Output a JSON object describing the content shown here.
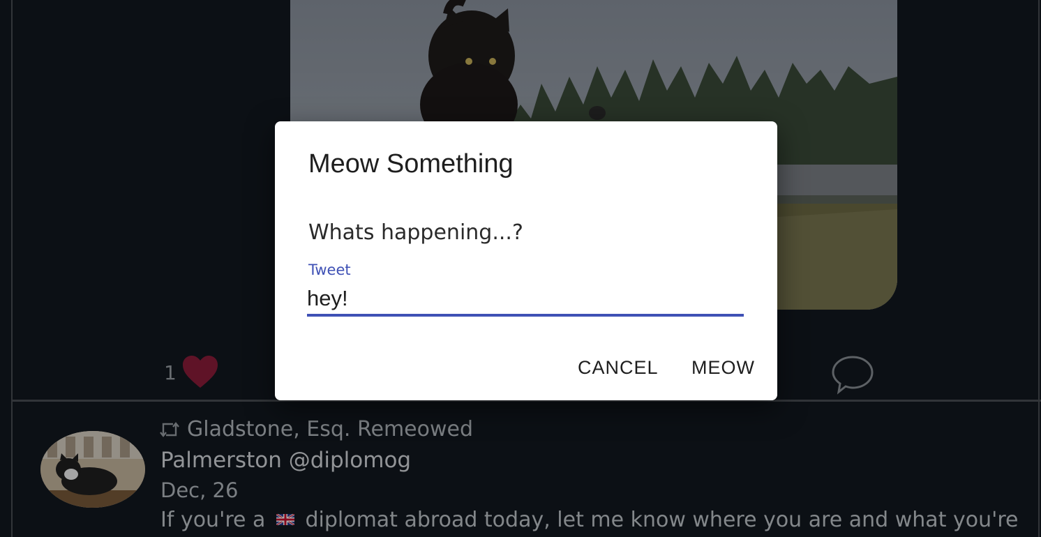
{
  "tweet": {
    "like_count": "1",
    "icons": {
      "like": "heart-icon",
      "comment": "comment-bubble-icon"
    },
    "colors": {
      "heart": "#8c1d3a"
    }
  },
  "remeow_tweet": {
    "remeowed_by": "Gladstone, Esq. Remeowed",
    "author": "Palmerston @diplomog",
    "date": "Dec, 26",
    "text_before_flag": "If you're a",
    "text_after_flag": "diplomat abroad today, let me know where you are and what you're",
    "icons": {
      "retweet": "retweet-icon",
      "flag": "uk-flag-icon"
    }
  },
  "dialog": {
    "title": "Meow Something",
    "prompt": "Whats happening...?",
    "field_label": "Tweet",
    "field_value": "hey!",
    "cancel_label": "CANCEL",
    "submit_label": "MEOW",
    "colors": {
      "accent": "#3f51b5"
    }
  }
}
